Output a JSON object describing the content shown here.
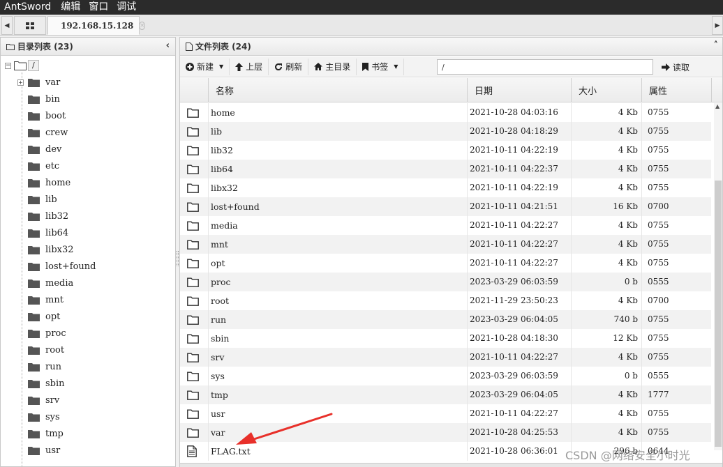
{
  "menubar": {
    "app": "AntSword",
    "items": [
      "编辑",
      "窗口",
      "调试"
    ]
  },
  "tabs": {
    "active_label": "192.168.15.128"
  },
  "left_panel": {
    "title": "目录列表 (23)",
    "root_label": "/",
    "folders": [
      "var",
      "bin",
      "boot",
      "crew",
      "dev",
      "etc",
      "home",
      "lib",
      "lib32",
      "lib64",
      "libx32",
      "lost+found",
      "media",
      "mnt",
      "opt",
      "proc",
      "root",
      "run",
      "sbin",
      "srv",
      "sys",
      "tmp",
      "usr"
    ]
  },
  "right_panel": {
    "title": "文件列表 (24)",
    "toolbar": {
      "new_label": "新建",
      "up_label": "上层",
      "refresh_label": "刷新",
      "home_label": "主目录",
      "bookmark_label": "书签",
      "path_value": "/",
      "read_label": "读取"
    },
    "columns": {
      "name": "名称",
      "date": "日期",
      "size": "大小",
      "attr": "属性"
    },
    "rows": [
      {
        "type": "folder",
        "name": "home",
        "date": "2021-10-28 04:03:16",
        "size": "4 Kb",
        "attr": "0755"
      },
      {
        "type": "folder",
        "name": "lib",
        "date": "2021-10-28 04:18:29",
        "size": "4 Kb",
        "attr": "0755"
      },
      {
        "type": "folder",
        "name": "lib32",
        "date": "2021-10-11 04:22:19",
        "size": "4 Kb",
        "attr": "0755"
      },
      {
        "type": "folder",
        "name": "lib64",
        "date": "2021-10-11 04:22:37",
        "size": "4 Kb",
        "attr": "0755"
      },
      {
        "type": "folder",
        "name": "libx32",
        "date": "2021-10-11 04:22:19",
        "size": "4 Kb",
        "attr": "0755"
      },
      {
        "type": "folder",
        "name": "lost+found",
        "date": "2021-10-11 04:21:51",
        "size": "16 Kb",
        "attr": "0700"
      },
      {
        "type": "folder",
        "name": "media",
        "date": "2021-10-11 04:22:27",
        "size": "4 Kb",
        "attr": "0755"
      },
      {
        "type": "folder",
        "name": "mnt",
        "date": "2021-10-11 04:22:27",
        "size": "4 Kb",
        "attr": "0755"
      },
      {
        "type": "folder",
        "name": "opt",
        "date": "2021-10-11 04:22:27",
        "size": "4 Kb",
        "attr": "0755"
      },
      {
        "type": "folder",
        "name": "proc",
        "date": "2023-03-29 06:03:59",
        "size": "0 b",
        "attr": "0555"
      },
      {
        "type": "folder",
        "name": "root",
        "date": "2021-11-29 23:50:23",
        "size": "4 Kb",
        "attr": "0700"
      },
      {
        "type": "folder",
        "name": "run",
        "date": "2023-03-29 06:04:05",
        "size": "740 b",
        "attr": "0755"
      },
      {
        "type": "folder",
        "name": "sbin",
        "date": "2021-10-28 04:18:30",
        "size": "12 Kb",
        "attr": "0755"
      },
      {
        "type": "folder",
        "name": "srv",
        "date": "2021-10-11 04:22:27",
        "size": "4 Kb",
        "attr": "0755"
      },
      {
        "type": "folder",
        "name": "sys",
        "date": "2023-03-29 06:03:59",
        "size": "0 b",
        "attr": "0555"
      },
      {
        "type": "folder",
        "name": "tmp",
        "date": "2023-03-29 06:04:05",
        "size": "4 Kb",
        "attr": "1777"
      },
      {
        "type": "folder",
        "name": "usr",
        "date": "2021-10-11 04:22:27",
        "size": "4 Kb",
        "attr": "0755"
      },
      {
        "type": "folder",
        "name": "var",
        "date": "2021-10-28 04:25:53",
        "size": "4 Kb",
        "attr": "0755"
      },
      {
        "type": "file",
        "name": "FLAG.txt",
        "date": "2021-10-28 06:36:01",
        "size": "296 b",
        "attr": "0644"
      }
    ]
  },
  "annotation": {
    "arrow_color": "#e8302a"
  },
  "watermark": "CSDN @网络安全小时光"
}
